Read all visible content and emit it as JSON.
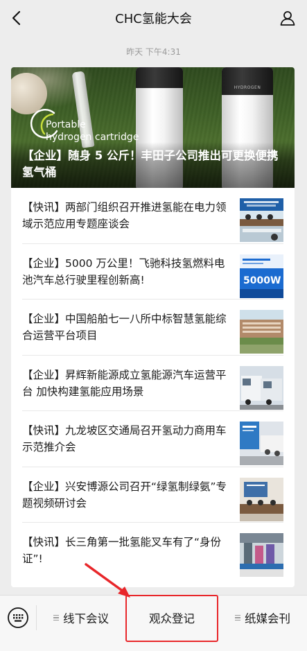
{
  "header": {
    "title": "CHC氢能大会",
    "back_icon": "chevron-left-icon",
    "profile_icon": "person-icon"
  },
  "timestamp": "昨天 下午4:31",
  "hero": {
    "caption_line1": "Portable",
    "caption_line2": "hydrogen cartridge",
    "headline": "【企业】随身 5 公斤！丰田子公司推出可更换便携氢气桶",
    "cylinder_brand": "HYDROGEN"
  },
  "news": [
    {
      "title": "【快讯】两部门组织召开推进氢能在电力领域示范应用专题座谈会",
      "thumb_caption": ""
    },
    {
      "title": "【企业】5000 万公里！飞驰科技氢燃料电池汽车总行驶里程创新高!",
      "thumb_caption": "5000W"
    },
    {
      "title": "【企业】中国船舶七一八所中标智慧氢能综合运营平台项目",
      "thumb_caption": ""
    },
    {
      "title": "【企业】昇辉新能源成立氢能源汽车运营平台 加快构建氢能应用场景",
      "thumb_caption": ""
    },
    {
      "title": "【快讯】九龙坡区交通局召开氢动力商用车示范推介会",
      "thumb_caption": ""
    },
    {
      "title": "【企业】兴安博源公司召开“绿氢制绿氨”专题视频研讨会",
      "thumb_caption": ""
    },
    {
      "title": "【快讯】长三角第一批氢能叉车有了“身份证”!",
      "thumb_caption": ""
    }
  ],
  "bottom_menu": {
    "keyboard_icon": "keyboard-icon",
    "items": [
      {
        "label": "线下会议",
        "has_submenu": true
      },
      {
        "label": "观众登记",
        "has_submenu": false
      },
      {
        "label": "纸媒会刊",
        "has_submenu": true
      }
    ]
  },
  "colors": {
    "background": "#ededed",
    "card": "#ffffff",
    "highlight": "#e8262a"
  }
}
